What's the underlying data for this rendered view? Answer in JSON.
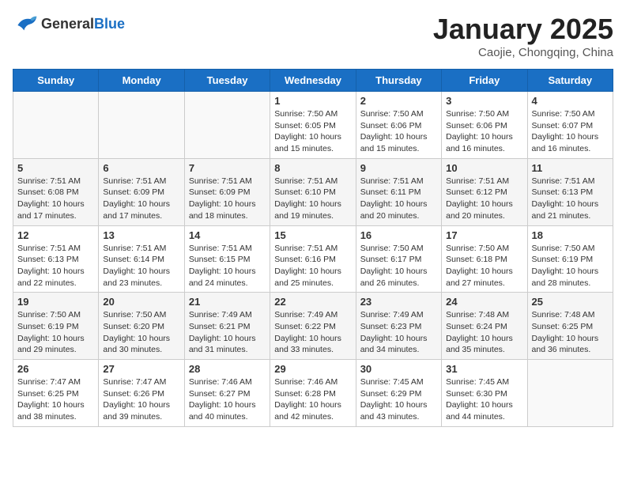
{
  "header": {
    "logo_general": "General",
    "logo_blue": "Blue",
    "title": "January 2025",
    "subtitle": "Caojie, Chongqing, China"
  },
  "weekdays": [
    "Sunday",
    "Monday",
    "Tuesday",
    "Wednesday",
    "Thursday",
    "Friday",
    "Saturday"
  ],
  "weeks": [
    [
      {
        "day": "",
        "info": ""
      },
      {
        "day": "",
        "info": ""
      },
      {
        "day": "",
        "info": ""
      },
      {
        "day": "1",
        "info": "Sunrise: 7:50 AM\nSunset: 6:05 PM\nDaylight: 10 hours and 15 minutes."
      },
      {
        "day": "2",
        "info": "Sunrise: 7:50 AM\nSunset: 6:06 PM\nDaylight: 10 hours and 15 minutes."
      },
      {
        "day": "3",
        "info": "Sunrise: 7:50 AM\nSunset: 6:06 PM\nDaylight: 10 hours and 16 minutes."
      },
      {
        "day": "4",
        "info": "Sunrise: 7:50 AM\nSunset: 6:07 PM\nDaylight: 10 hours and 16 minutes."
      }
    ],
    [
      {
        "day": "5",
        "info": "Sunrise: 7:51 AM\nSunset: 6:08 PM\nDaylight: 10 hours and 17 minutes."
      },
      {
        "day": "6",
        "info": "Sunrise: 7:51 AM\nSunset: 6:09 PM\nDaylight: 10 hours and 17 minutes."
      },
      {
        "day": "7",
        "info": "Sunrise: 7:51 AM\nSunset: 6:09 PM\nDaylight: 10 hours and 18 minutes."
      },
      {
        "day": "8",
        "info": "Sunrise: 7:51 AM\nSunset: 6:10 PM\nDaylight: 10 hours and 19 minutes."
      },
      {
        "day": "9",
        "info": "Sunrise: 7:51 AM\nSunset: 6:11 PM\nDaylight: 10 hours and 20 minutes."
      },
      {
        "day": "10",
        "info": "Sunrise: 7:51 AM\nSunset: 6:12 PM\nDaylight: 10 hours and 20 minutes."
      },
      {
        "day": "11",
        "info": "Sunrise: 7:51 AM\nSunset: 6:13 PM\nDaylight: 10 hours and 21 minutes."
      }
    ],
    [
      {
        "day": "12",
        "info": "Sunrise: 7:51 AM\nSunset: 6:13 PM\nDaylight: 10 hours and 22 minutes."
      },
      {
        "day": "13",
        "info": "Sunrise: 7:51 AM\nSunset: 6:14 PM\nDaylight: 10 hours and 23 minutes."
      },
      {
        "day": "14",
        "info": "Sunrise: 7:51 AM\nSunset: 6:15 PM\nDaylight: 10 hours and 24 minutes."
      },
      {
        "day": "15",
        "info": "Sunrise: 7:51 AM\nSunset: 6:16 PM\nDaylight: 10 hours and 25 minutes."
      },
      {
        "day": "16",
        "info": "Sunrise: 7:50 AM\nSunset: 6:17 PM\nDaylight: 10 hours and 26 minutes."
      },
      {
        "day": "17",
        "info": "Sunrise: 7:50 AM\nSunset: 6:18 PM\nDaylight: 10 hours and 27 minutes."
      },
      {
        "day": "18",
        "info": "Sunrise: 7:50 AM\nSunset: 6:19 PM\nDaylight: 10 hours and 28 minutes."
      }
    ],
    [
      {
        "day": "19",
        "info": "Sunrise: 7:50 AM\nSunset: 6:19 PM\nDaylight: 10 hours and 29 minutes."
      },
      {
        "day": "20",
        "info": "Sunrise: 7:50 AM\nSunset: 6:20 PM\nDaylight: 10 hours and 30 minutes."
      },
      {
        "day": "21",
        "info": "Sunrise: 7:49 AM\nSunset: 6:21 PM\nDaylight: 10 hours and 31 minutes."
      },
      {
        "day": "22",
        "info": "Sunrise: 7:49 AM\nSunset: 6:22 PM\nDaylight: 10 hours and 33 minutes."
      },
      {
        "day": "23",
        "info": "Sunrise: 7:49 AM\nSunset: 6:23 PM\nDaylight: 10 hours and 34 minutes."
      },
      {
        "day": "24",
        "info": "Sunrise: 7:48 AM\nSunset: 6:24 PM\nDaylight: 10 hours and 35 minutes."
      },
      {
        "day": "25",
        "info": "Sunrise: 7:48 AM\nSunset: 6:25 PM\nDaylight: 10 hours and 36 minutes."
      }
    ],
    [
      {
        "day": "26",
        "info": "Sunrise: 7:47 AM\nSunset: 6:25 PM\nDaylight: 10 hours and 38 minutes."
      },
      {
        "day": "27",
        "info": "Sunrise: 7:47 AM\nSunset: 6:26 PM\nDaylight: 10 hours and 39 minutes."
      },
      {
        "day": "28",
        "info": "Sunrise: 7:46 AM\nSunset: 6:27 PM\nDaylight: 10 hours and 40 minutes."
      },
      {
        "day": "29",
        "info": "Sunrise: 7:46 AM\nSunset: 6:28 PM\nDaylight: 10 hours and 42 minutes."
      },
      {
        "day": "30",
        "info": "Sunrise: 7:45 AM\nSunset: 6:29 PM\nDaylight: 10 hours and 43 minutes."
      },
      {
        "day": "31",
        "info": "Sunrise: 7:45 AM\nSunset: 6:30 PM\nDaylight: 10 hours and 44 minutes."
      },
      {
        "day": "",
        "info": ""
      }
    ]
  ]
}
